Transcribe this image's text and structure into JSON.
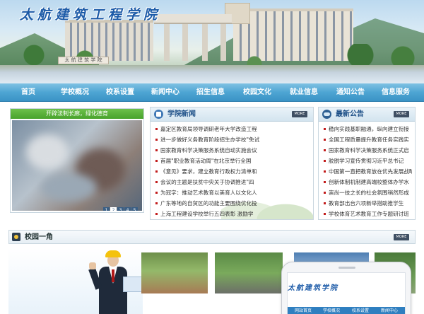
{
  "header": {
    "logo_text": "太航建筑工程学院",
    "sign_text": "太 航 建 筑 学 院"
  },
  "nav": {
    "items": [
      {
        "label": "首页"
      },
      {
        "label": "学校概况"
      },
      {
        "label": "校系设置"
      },
      {
        "label": "新闻中心"
      },
      {
        "label": "招生信息"
      },
      {
        "label": "校园文化"
      },
      {
        "label": "就业信息"
      },
      {
        "label": "通知公告"
      },
      {
        "label": "信息服务"
      }
    ]
  },
  "slider": {
    "caption": "开辟法制长廊，绿化德育",
    "dots": [
      "1",
      "2",
      "3",
      "4",
      "5"
    ],
    "active_dot_index": 1
  },
  "news": {
    "title": "学院新闻",
    "more_label": "MORE",
    "items": [
      "嘉定区教育局领导调研老年大学改造工程",
      "进一步做好义务教育阶段招生办学校\"免试",
      "国家教育科学决策服务系统自动实施会议",
      "首届\"职业教育活动周\"在北京举行全国",
      "《意见》要求，建立教育行政权力清单和",
      "会议的主题是扶贫中央关于协调推进\"四",
      "为冠字：推动艺术教育以美育人以文化人",
      "广东等地的自贸区的功能主要围绕优化投",
      "上海工程建设学校举行五四表彰 激励学"
    ]
  },
  "notices": {
    "title": "最新公告",
    "more_label": "MORE",
    "items": [
      "稳向实践基职融通，纵向建立衔接",
      "全国工程质量提升教育任务实践实",
      "国家教育科学决策服务系统正式启",
      "胶脱学习宣传贯彻习近平总书记",
      "中国第一直把教育放在优先发展战略",
      "创新体制机制建高端校整体办学水",
      "崇尚一技之长的社会氛围稍然形成",
      "教育部出台六项新举措助推学生",
      "学校体育艺术教育工作专题研讨班"
    ]
  },
  "campus": {
    "title": "校园一角",
    "more_label": "MORE"
  },
  "phone": {
    "logo_text": "太航建筑学院",
    "nav": [
      "网站首页",
      "学校概况",
      "校系设置",
      "新闻中心"
    ]
  },
  "colors": {
    "nav_bg": "#4ea5d3",
    "accent_blue": "#1b4e86",
    "slider_caption_bg": "#48a32c",
    "bullet_red": "#c21b1b"
  }
}
